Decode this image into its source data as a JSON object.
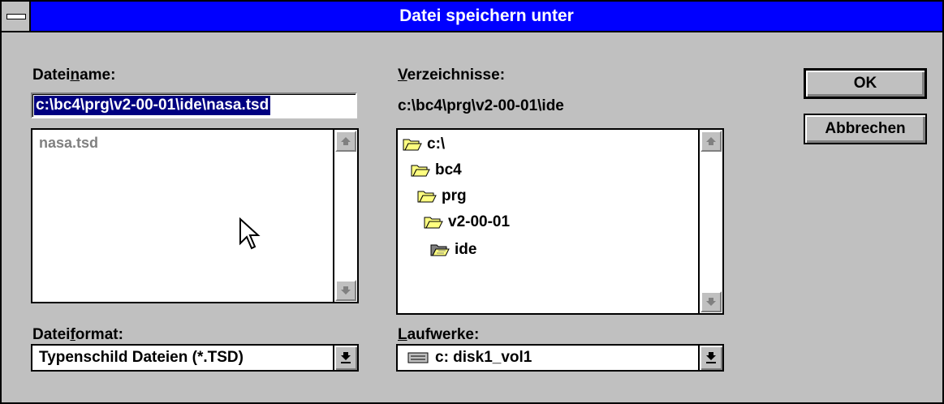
{
  "dialog": {
    "title": "Datei speichern unter"
  },
  "filename": {
    "label_pre": "Datei",
    "label_accel": "n",
    "label_post": "ame:",
    "value": "c:\\bc4\\prg\\v2-00-01\\ide\\nasa.tsd",
    "files": [
      "nasa.tsd"
    ]
  },
  "directories": {
    "label_accel": "V",
    "label_post": "erzeichnisse:",
    "current_path": "c:\\bc4\\prg\\v2-00-01\\ide",
    "items": [
      "c:\\",
      "bc4",
      "prg",
      "v2-00-01",
      "ide"
    ]
  },
  "fileformat": {
    "label_pre": "Datei",
    "label_accel": "f",
    "label_post": "ormat:",
    "selected": "Typenschild Dateien (*.TSD)"
  },
  "drives": {
    "label_accel": "L",
    "label_post": "aufwerke:",
    "selected": "c: disk1_vol1"
  },
  "buttons": {
    "ok": "OK",
    "cancel": "Abbrechen"
  },
  "colors": {
    "titlebar": "#0000ff",
    "dialog_bg": "#c0c0c0",
    "selection": "#000080",
    "folder_fill": "#ffff80"
  }
}
